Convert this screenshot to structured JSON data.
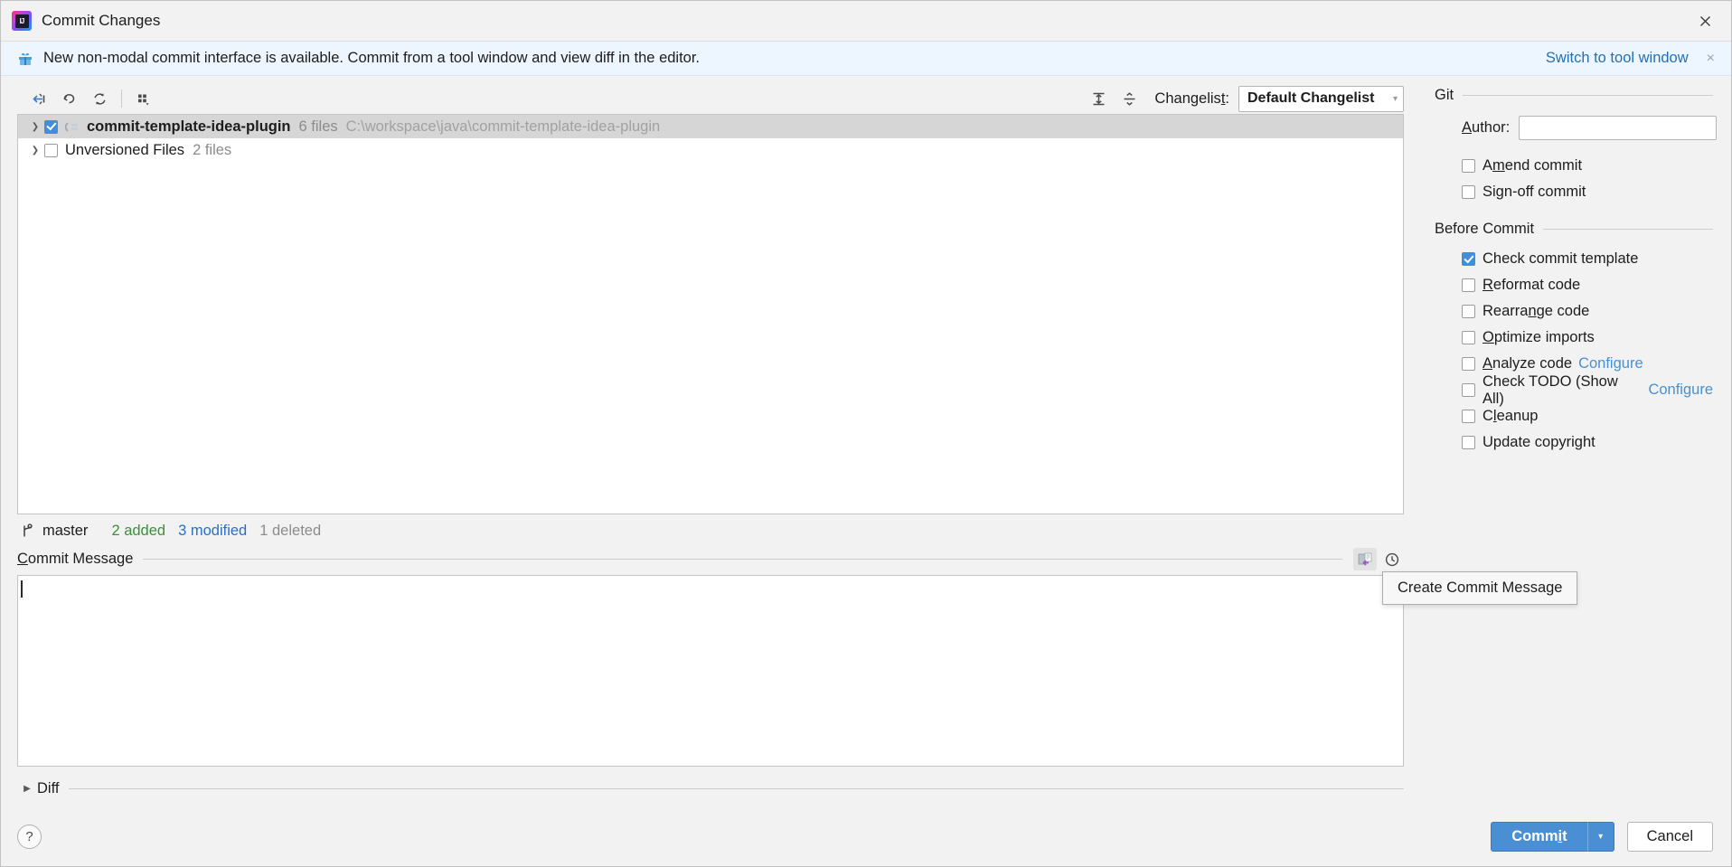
{
  "window": {
    "title": "Commit Changes",
    "logo_text": "IJ",
    "close_icon": "close-icon"
  },
  "banner": {
    "icon": "gift-icon",
    "text": "New non-modal commit interface is available. Commit from a tool window and view diff in the editor.",
    "link": "Switch to tool window",
    "close": "×"
  },
  "toolbar": {
    "buttons": [
      {
        "name": "move-to-another-changelist-icon",
        "title": "Move to Another Changelist"
      },
      {
        "name": "rollback-icon",
        "title": "Rollback"
      },
      {
        "name": "refresh-icon",
        "title": "Refresh"
      },
      {
        "name": "group-by-icon",
        "title": "Group By"
      }
    ],
    "expand_all": "expand-all-icon",
    "collapse_all": "collapse-all-icon",
    "changelist_label": "Changelist:",
    "changelist_mnemonic": "t",
    "changelist_value": "Default Changelist",
    "changelist_options": [
      "Default Changelist"
    ]
  },
  "tree": {
    "rows": [
      {
        "name": "commit-template-idea-plugin",
        "meta": "6 files",
        "path": "C:\\workspace\\java\\commit-template-idea-plugin",
        "checked": true,
        "selected": true,
        "expanded": false,
        "icon": "changelist-icon"
      },
      {
        "name": "Unversioned Files",
        "meta": "2 files",
        "path": "",
        "checked": false,
        "selected": false,
        "expanded": false,
        "icon": ""
      }
    ]
  },
  "status": {
    "branch_icon": "git-branch-icon",
    "branch": "master",
    "added": "2 added",
    "modified": "3 modified",
    "deleted": "1 deleted"
  },
  "commit_message": {
    "label": "Commit Message",
    "label_mnemonic": "C",
    "value": "",
    "placeholder": "",
    "buttons": [
      {
        "name": "create-commit-message-icon",
        "label": "Create Commit Message",
        "active": true
      },
      {
        "name": "message-history-icon",
        "label": "Show history",
        "active": false
      }
    ],
    "tooltip": "Create Commit Message"
  },
  "diff": {
    "label": "Diff",
    "expanded": false
  },
  "sidebar": {
    "git": {
      "title": "Git",
      "author_label": "Author:",
      "author_mnemonic": "A",
      "author_value": "",
      "options": [
        {
          "label": "Amend commit",
          "mnemonic": "m",
          "checked": false,
          "name": "amend-commit"
        },
        {
          "label": "Sign-off commit",
          "mnemonic": "",
          "checked": false,
          "name": "sign-off-commit"
        }
      ]
    },
    "before_commit": {
      "title": "Before Commit",
      "options": [
        {
          "label": "Check commit template",
          "mnemonic": "",
          "checked": true,
          "link": "",
          "name": "check-commit-template"
        },
        {
          "label": "Reformat code",
          "mnemonic": "R",
          "checked": false,
          "link": "",
          "name": "reformat-code"
        },
        {
          "label": "Rearrange code",
          "mnemonic": "n",
          "checked": false,
          "link": "",
          "name": "rearrange-code"
        },
        {
          "label": "Optimize imports",
          "mnemonic": "O",
          "checked": false,
          "link": "",
          "name": "optimize-imports"
        },
        {
          "label": "Analyze code",
          "mnemonic": "A",
          "checked": false,
          "link": "Configure",
          "name": "analyze-code"
        },
        {
          "label": "Check TODO (Show All)",
          "mnemonic": "",
          "checked": false,
          "link": "Configure",
          "name": "check-todo"
        },
        {
          "label": "Cleanup",
          "mnemonic": "l",
          "checked": false,
          "link": "",
          "name": "cleanup"
        },
        {
          "label": "Update copyright",
          "mnemonic": "",
          "checked": false,
          "link": "",
          "name": "update-copyright"
        }
      ]
    }
  },
  "footer": {
    "help": "?",
    "commit": "Commit",
    "commit_mnemonic": "i",
    "commit_arrow": "▾",
    "cancel": "Cancel"
  },
  "colors": {
    "accent_blue": "#4a8fd4",
    "link_blue": "#2470b3",
    "added_green": "#3c8f3c",
    "modified_blue": "#2b6fc4",
    "deleted_gray": "#8c8c8c",
    "banner_bg": "#edf6fe",
    "selection_gray": "#d6d6d6"
  }
}
